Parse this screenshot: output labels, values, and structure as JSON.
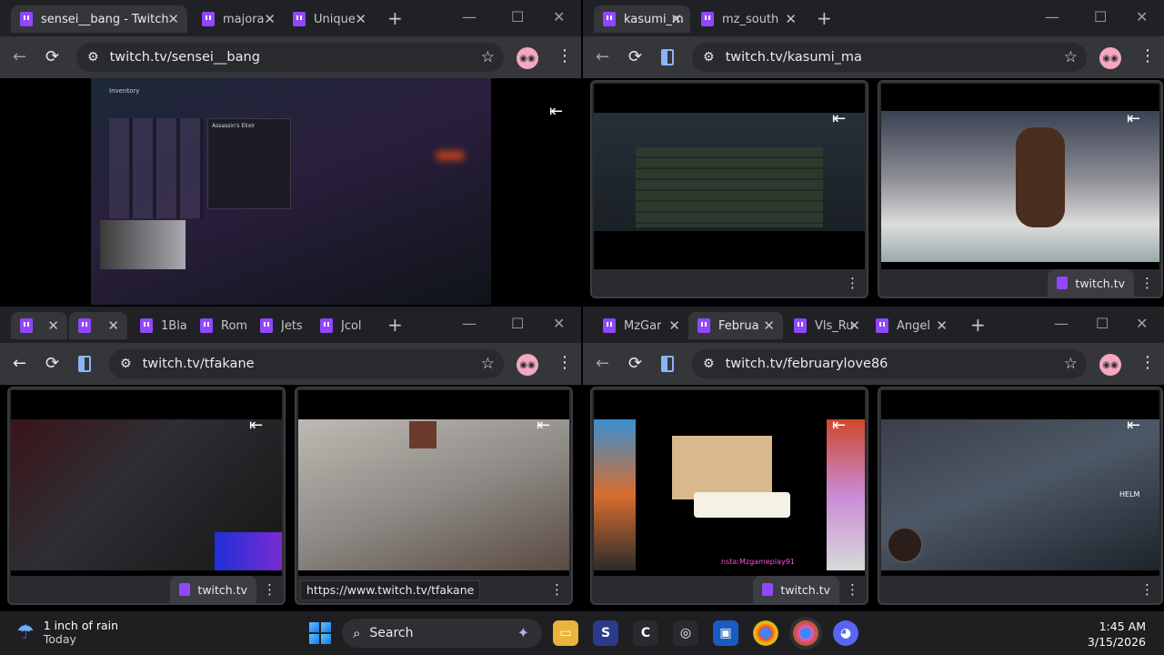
{
  "windows": [
    {
      "tabs": [
        {
          "label": "sensei__bang - Twitch"
        },
        {
          "label": "majora"
        },
        {
          "label": "Unique"
        }
      ],
      "url": "twitch.tv/sensei__bang"
    },
    {
      "tabs": [
        {
          "label": "kasumi_m"
        },
        {
          "label": "mz_south"
        }
      ],
      "url": "twitch.tv/kasumi_ma",
      "pane_site": "twitch.tv"
    },
    {
      "tabs": [
        {
          "label": ""
        },
        {
          "label": ""
        },
        {
          "label": "1Bla"
        },
        {
          "label": "Rom"
        },
        {
          "label": "Jets"
        },
        {
          "label": "Jcol"
        }
      ],
      "url": "twitch.tv/tfakane",
      "pane_site": "twitch.tv",
      "hover_url": "https://www.twitch.tv/tfakane"
    },
    {
      "tabs": [
        {
          "label": "MzGar"
        },
        {
          "label": "Februa"
        },
        {
          "label": "Vls_Ru"
        },
        {
          "label": "Angel"
        }
      ],
      "url": "twitch.tv/februarylove86",
      "pane_site": "twitch.tv"
    }
  ],
  "icons": {
    "back": "←",
    "reload": "⟳",
    "star": "☆",
    "menu": "⋮",
    "close": "✕",
    "newtab": "+",
    "minimize": "—",
    "maximize": "☐",
    "collapse": "⇤"
  },
  "colors": {
    "twitch": "#9146ff",
    "chrome_dark": "#202124",
    "toolbar": "#35363a"
  },
  "taskbar": {
    "weather_line1": "1 inch of rain",
    "weather_line2": "Today",
    "search_label": "Search",
    "time": "1:45 AM",
    "date": "3/15/2026"
  },
  "game_ui": {
    "inventory_title": "Inventory",
    "item_title": "Assassin's Elixir",
    "overlay_text": "nsta:Mzgameplay91",
    "hud_badge": "HELM"
  }
}
